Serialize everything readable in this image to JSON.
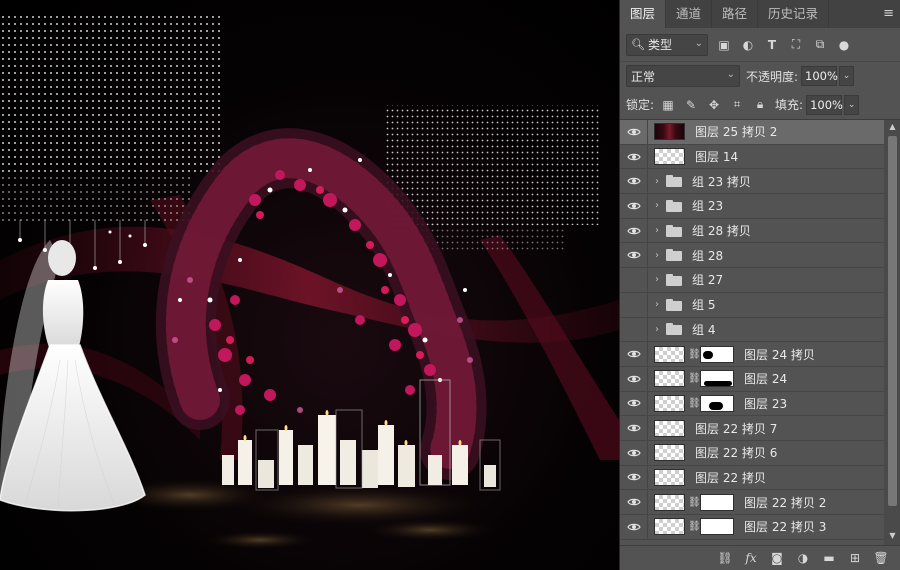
{
  "panel": {
    "tabs": [
      {
        "label": "图层",
        "active": true
      },
      {
        "label": "通道",
        "active": false
      },
      {
        "label": "路径",
        "active": false
      },
      {
        "label": "历史记录",
        "active": false
      }
    ],
    "filter": {
      "label": "类型"
    },
    "blend_mode": "正常",
    "opacity": {
      "label": "不透明度:",
      "value": "100%"
    },
    "lock": {
      "label": "锁定:"
    },
    "fill": {
      "label": "填充:",
      "value": "100%"
    },
    "layers": [
      {
        "name": "图层 25 拷贝 2",
        "visible": true,
        "kind": "photo",
        "selected": true
      },
      {
        "name": "图层 14",
        "visible": true,
        "kind": "pixel"
      },
      {
        "name": "组 23 拷贝",
        "visible": true,
        "kind": "group"
      },
      {
        "name": "组 23",
        "visible": true,
        "kind": "group"
      },
      {
        "name": "组 28 拷贝",
        "visible": true,
        "kind": "group"
      },
      {
        "name": "组 28",
        "visible": true,
        "kind": "group"
      },
      {
        "name": "组 27",
        "visible": false,
        "kind": "group"
      },
      {
        "name": "组 5",
        "visible": false,
        "kind": "group"
      },
      {
        "name": "组 4",
        "visible": false,
        "kind": "group"
      },
      {
        "name": "图层 24 拷贝",
        "visible": true,
        "kind": "masked"
      },
      {
        "name": "图层 24",
        "visible": true,
        "kind": "masked"
      },
      {
        "name": "图层 23",
        "visible": true,
        "kind": "masked"
      },
      {
        "name": "图层 22 拷贝 7",
        "visible": true,
        "kind": "pixel"
      },
      {
        "name": "图层 22 拷贝 6",
        "visible": true,
        "kind": "pixel"
      },
      {
        "name": "图层 22 拷贝",
        "visible": true,
        "kind": "pixel"
      },
      {
        "name": "图层 22 拷贝 2",
        "visible": true,
        "kind": "masked"
      },
      {
        "name": "图层 22 拷贝 3",
        "visible": true,
        "kind": "masked"
      }
    ],
    "bottom_icons": [
      "link-icon",
      "fx-icon",
      "add-mask-icon",
      "adjustment-icon",
      "new-group-icon",
      "new-layer-icon",
      "delete-icon"
    ]
  },
  "colors": {
    "panel_bg": "#535353",
    "tab_bar": "#424242",
    "selected_row": "#6a6a6a",
    "rose": "#c2185b",
    "drape": "#6b0f24"
  }
}
